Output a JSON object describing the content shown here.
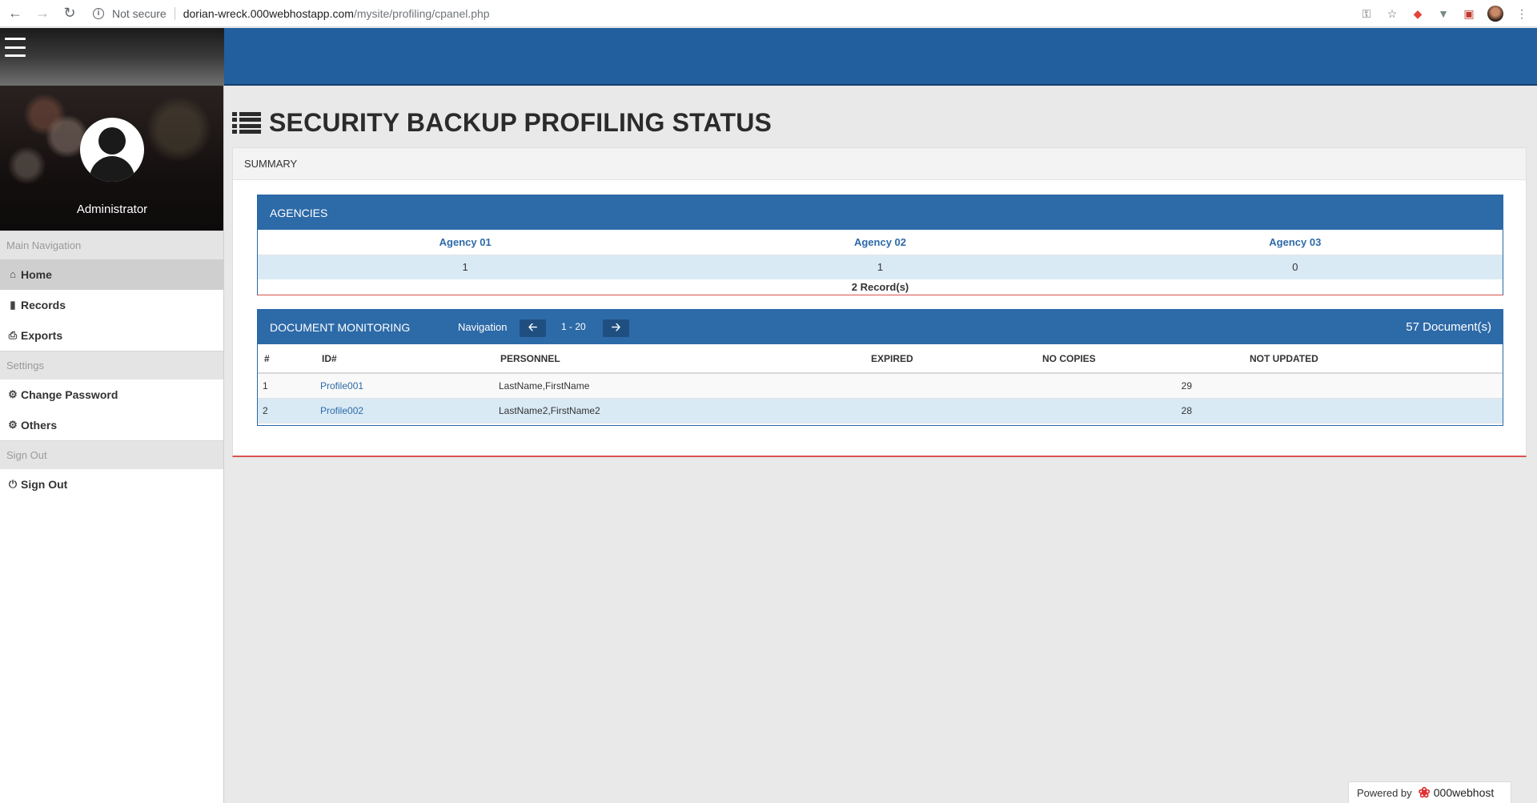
{
  "browser": {
    "security_label": "Not secure",
    "url_host": "dorian-wreck.000webhostapp.com",
    "url_path": "/mysite/profiling/cpanel.php"
  },
  "sidebar": {
    "user_name": "Administrator",
    "sections": [
      {
        "header": "Main Navigation",
        "items": [
          {
            "label": "Home",
            "icon": "home-icon",
            "active": true
          },
          {
            "label": "Records",
            "icon": "file-icon"
          },
          {
            "label": "Exports",
            "icon": "print-icon"
          }
        ]
      },
      {
        "header": "Settings",
        "items": [
          {
            "label": "Change Password",
            "icon": "gear-icon"
          },
          {
            "label": "Others",
            "icon": "gears-icon"
          }
        ]
      },
      {
        "header": "Sign Out",
        "items": [
          {
            "label": "Sign Out",
            "icon": "power-icon"
          }
        ]
      }
    ]
  },
  "page": {
    "title": "SECURITY BACKUP PROFILING STATUS",
    "summary_label": "SUMMARY"
  },
  "agencies": {
    "title": "AGENCIES",
    "columns": [
      "Agency 01",
      "Agency 02",
      "Agency 03"
    ],
    "values": [
      "1",
      "1",
      "0"
    ],
    "records_text": "2 Record(s)"
  },
  "documents": {
    "title": "DOCUMENT MONITORING",
    "navigation_label": "Navigation",
    "range": "1 - 20",
    "count_text": "57 Document(s)",
    "columns": [
      "#",
      "ID#",
      "PERSONNEL",
      "EXPIRED",
      "NO COPIES",
      "NOT UPDATED"
    ],
    "rows": [
      {
        "num": "1",
        "id": "Profile001",
        "personnel": "LastName,FirstName",
        "expired": "",
        "no_copies": "29",
        "not_updated": ""
      },
      {
        "num": "2",
        "id": "Profile002",
        "personnel": "LastName2,FirstName2",
        "expired": "",
        "no_copies": "28",
        "not_updated": ""
      }
    ]
  },
  "footer": {
    "powered_by": "Powered by",
    "brand": "000webhost"
  },
  "colors": {
    "header_blue": "#225f9f",
    "panel_blue": "#2d6aa8",
    "accent_red": "#d9534f"
  }
}
